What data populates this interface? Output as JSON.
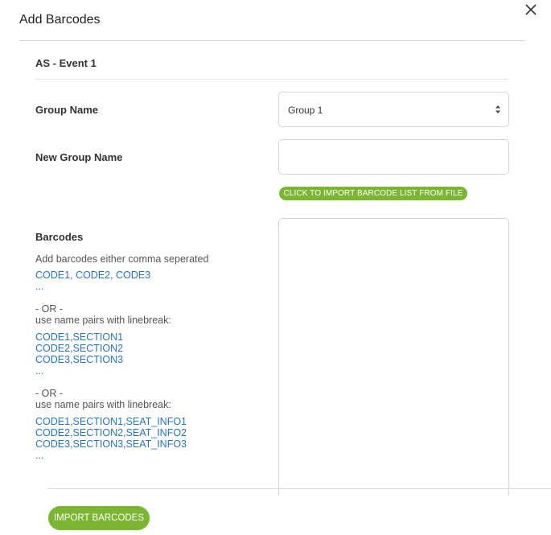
{
  "modal": {
    "title": "Add Barcodes",
    "event_name": "AS - Event 1"
  },
  "form": {
    "group_name_label": "Group Name",
    "group_name_selected": "Group 1",
    "new_group_name_label": "New Group Name",
    "new_group_name_value": "",
    "import_file_label": "CLICK TO IMPORT BARCODE LIST FROM FILE",
    "barcodes_label": "Barcodes",
    "barcodes_value": ""
  },
  "instructions": {
    "intro": "Add barcodes either comma seperated",
    "example1": [
      "CODE1, CODE2, CODE3",
      "..."
    ],
    "or1": "- OR -",
    "pairs1_label": "use name pairs with linebreak:",
    "example2": [
      "CODE1,SECTION1",
      "CODE2,SECTION2",
      "CODE3,SECTION3",
      "..."
    ],
    "or2": "- OR -",
    "pairs2_label": "use name pairs with linebreak:",
    "example3": [
      "CODE1,SECTION1,SEAT_INFO1",
      "CODE2,SECTION2,SEAT_INFO2",
      "CODE3,SECTION3,SEAT_INFO3",
      "..."
    ]
  },
  "footer": {
    "import_button": "IMPORT BARCODES"
  },
  "colors": {
    "accent_green": "#7cb531",
    "link_blue": "#2575c4"
  }
}
